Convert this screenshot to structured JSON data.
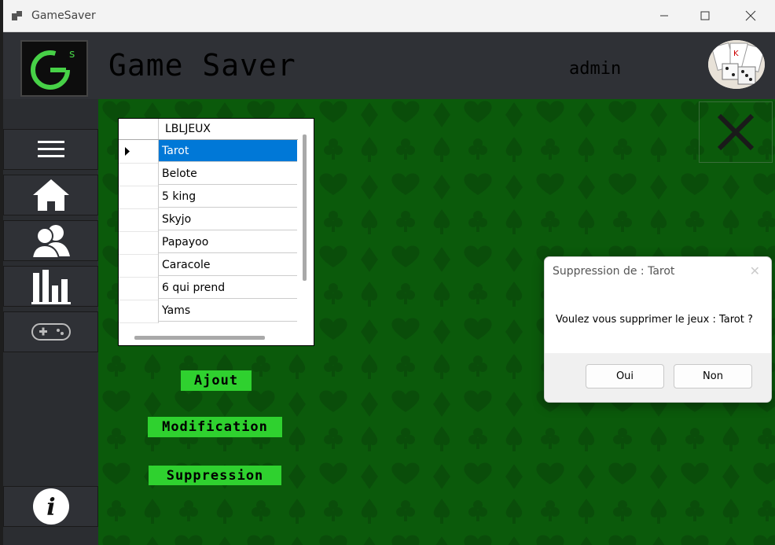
{
  "window": {
    "title": "GameSaver"
  },
  "header": {
    "app_title": "Game Saver",
    "username": "admin",
    "logo_text": "GS"
  },
  "grid": {
    "column_header": "LBLJEUX",
    "rows": [
      "Tarot",
      "Belote",
      "5 king",
      "Skyjo",
      "Papayoo",
      "Caracole",
      "6 qui prend",
      "Yams"
    ],
    "selected_row": "Tarot"
  },
  "actions": {
    "add": "Ajout",
    "edit": "Modification",
    "delete": "Suppression"
  },
  "dialog": {
    "title": "Suppression de : Tarot",
    "message": "Voulez vous supprimer le jeux : Tarot ?",
    "yes": "Oui",
    "no": "Non"
  },
  "colors": {
    "background_green": "#0b5a0b",
    "button_green": "#2fd12f",
    "selection_blue": "#0078d7",
    "sidebar": "#2b2d31"
  },
  "icons": [
    "menu-icon",
    "home-icon",
    "users-icon",
    "chart-icon",
    "gamepad-icon",
    "info-icon",
    "close-icon"
  ]
}
